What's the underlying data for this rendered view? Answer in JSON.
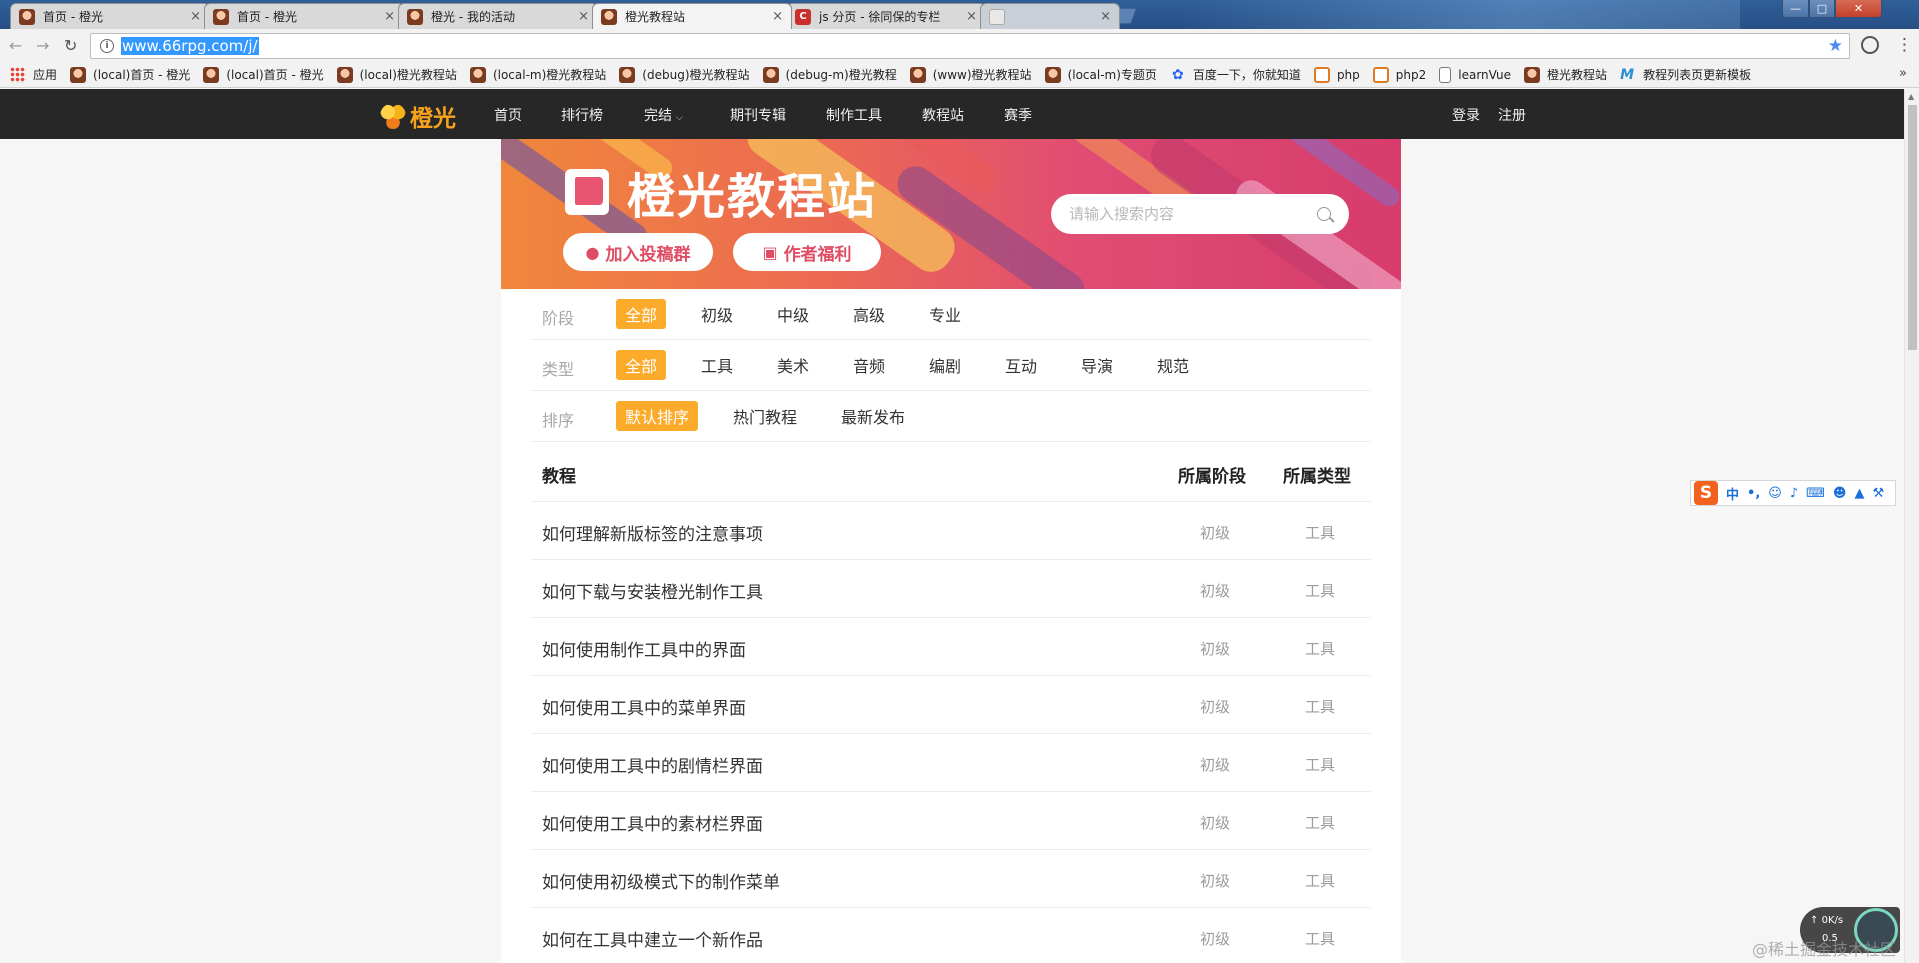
{
  "browser": {
    "tabs": [
      {
        "title": "首页 - 橙光",
        "favicon": "anime-avatar-icon"
      },
      {
        "title": "首页 - 橙光",
        "favicon": "anime-avatar-icon"
      },
      {
        "title": "橙光 - 我的活动",
        "favicon": "anime-avatar-icon"
      },
      {
        "title": "橙光教程站",
        "favicon": "anime-avatar-icon",
        "active": true
      },
      {
        "title": "js 分页 - 徐同保的专栏",
        "favicon": "csdn-icon"
      },
      {
        "title": "",
        "favicon": "blank-page-icon"
      }
    ],
    "tab_close": "×",
    "address": "www.66rpg.com/j/",
    "bookmarks": [
      {
        "label": "应用",
        "icon": "apps-icon"
      },
      {
        "label": "(local)首页 - 橙光",
        "icon": "anime-avatar-icon"
      },
      {
        "label": "(local)首页 - 橙光",
        "icon": "anime-avatar-icon"
      },
      {
        "label": "(local)橙光教程站",
        "icon": "anime-avatar-icon"
      },
      {
        "label": "(local-m)橙光教程站",
        "icon": "anime-avatar-icon"
      },
      {
        "label": "(debug)橙光教程站",
        "icon": "anime-avatar-icon"
      },
      {
        "label": "(debug-m)橙光教程",
        "icon": "anime-avatar-icon"
      },
      {
        "label": "(www)橙光教程站",
        "icon": "anime-avatar-icon"
      },
      {
        "label": "(local-m)专题页",
        "icon": "anime-avatar-icon"
      },
      {
        "label": "百度一下，你就知道",
        "icon": "baidu-paw-icon"
      },
      {
        "label": "php",
        "icon": "php-icon"
      },
      {
        "label": "php2",
        "icon": "php-icon"
      },
      {
        "label": "learnVue",
        "icon": "document-icon"
      },
      {
        "label": "橙光教程站",
        "icon": "anime-avatar-icon"
      },
      {
        "label": "教程列表页更新模板",
        "icon": "m-logo-icon"
      }
    ],
    "bookmarks_more": "»"
  },
  "site": {
    "logo_text": "橙光",
    "nav": [
      "首页",
      "排行榜",
      "完结",
      "期刊专辑",
      "制作工具",
      "教程站",
      "赛季"
    ],
    "login": "登录",
    "register": "注册"
  },
  "banner": {
    "title": "橙光教程站",
    "join_button": "加入投稿群",
    "welfare_button": "作者福利",
    "search_placeholder": "请输入搜索内容"
  },
  "filters": {
    "stage": {
      "label": "阶段",
      "options": [
        "全部",
        "初级",
        "中级",
        "高级",
        "专业"
      ],
      "selected": "全部"
    },
    "type": {
      "label": "类型",
      "options": [
        "全部",
        "工具",
        "美术",
        "音频",
        "编剧",
        "互动",
        "导演",
        "规范"
      ],
      "selected": "全部"
    },
    "sort": {
      "label": "排序",
      "options": [
        "默认排序",
        "热门教程",
        "最新发布"
      ],
      "selected": "默认排序"
    }
  },
  "table": {
    "headers": {
      "name": "教程",
      "stage": "所属阶段",
      "type": "所属类型"
    },
    "rows": [
      {
        "name": "如何理解新版标签的注意事项",
        "stage": "初级",
        "type": "工具"
      },
      {
        "name": "如何下载与安装橙光制作工具",
        "stage": "初级",
        "type": "工具"
      },
      {
        "name": "如何使用制作工具中的界面",
        "stage": "初级",
        "type": "工具"
      },
      {
        "name": "如何使用工具中的菜单界面",
        "stage": "初级",
        "type": "工具"
      },
      {
        "name": "如何使用工具中的剧情栏界面",
        "stage": "初级",
        "type": "工具"
      },
      {
        "name": "如何使用工具中的素材栏界面",
        "stage": "初级",
        "type": "工具"
      },
      {
        "name": "如何使用初级模式下的制作菜单",
        "stage": "初级",
        "type": "工具"
      },
      {
        "name": "如何在工具中建立一个新作品",
        "stage": "初级",
        "type": "工具"
      }
    ]
  },
  "ime": {
    "logo": "S",
    "mode": "中",
    "punct": "•,"
  },
  "speed_widget": {
    "up": "0K/s",
    "down": "0.5"
  },
  "watermark": "@稀土掘金技术社区",
  "colors": {
    "accent": "#fbaa2a",
    "nav_bg": "#272727",
    "banner_pink": "#e04c63",
    "selection": "#3399ff"
  }
}
